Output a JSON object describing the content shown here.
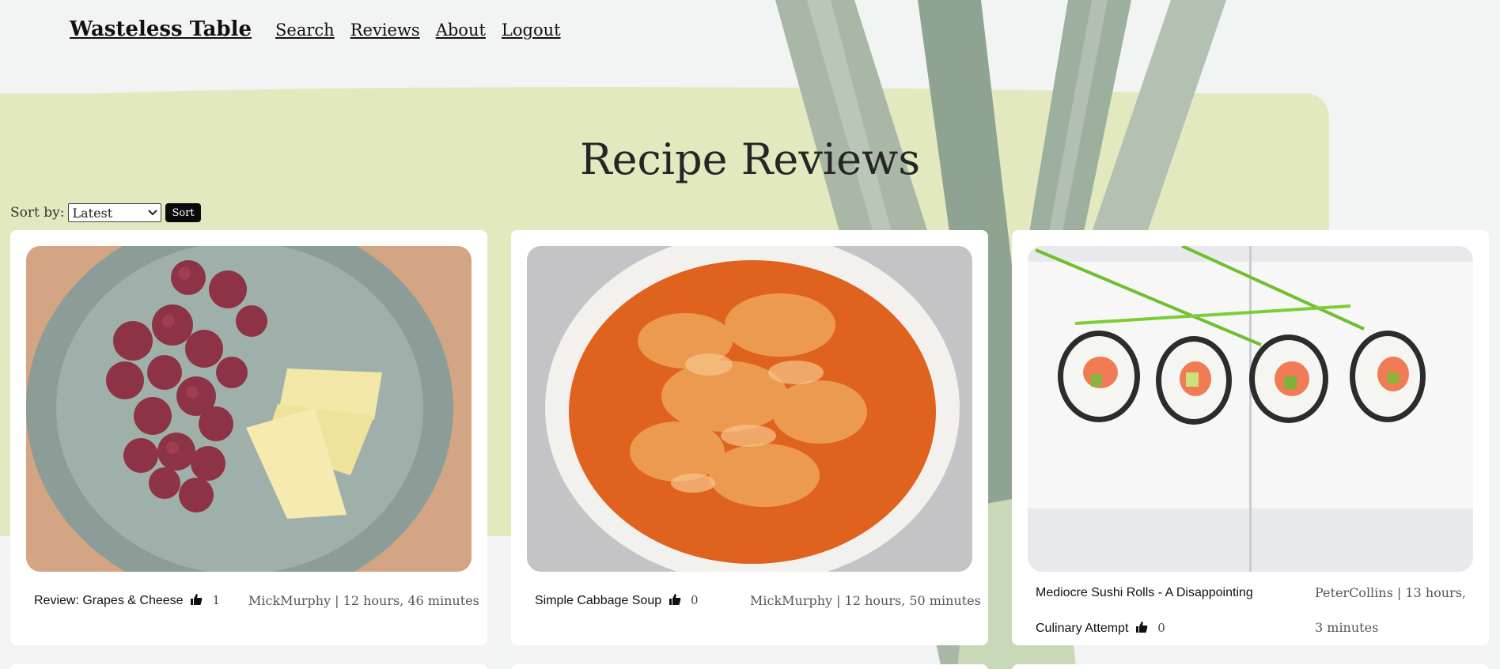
{
  "nav": {
    "brand": "Wasteless Table",
    "links": [
      "Search",
      "Reviews",
      "About",
      "Logout"
    ]
  },
  "page": {
    "title": "Recipe Reviews"
  },
  "sort": {
    "label": "Sort by:",
    "selected": "Latest",
    "button": "Sort"
  },
  "reviews": [
    {
      "title": "Review: Grapes & Cheese",
      "likes": "1",
      "author_time": "MickMurphy | 12 hours, 46 minutes"
    },
    {
      "title": "Simple Cabbage Soup",
      "likes": "0",
      "author_time": "MickMurphy | 12 hours, 50 minutes"
    },
    {
      "title_line1": "Mediocre Sushi Rolls - A Disappointing",
      "title_line2": "Culinary Attempt",
      "likes": "0",
      "author_line1": "PeterCollins | 13 hours,",
      "author_line2": "3 minutes"
    }
  ],
  "colors": {
    "background": "#f1f4f2",
    "wash": "#e3e9bf",
    "card": "#ffffff",
    "button": "#0a0a0a"
  },
  "icons": {
    "likes": "thumbs-up-icon",
    "select": "chevron-down-icon"
  }
}
